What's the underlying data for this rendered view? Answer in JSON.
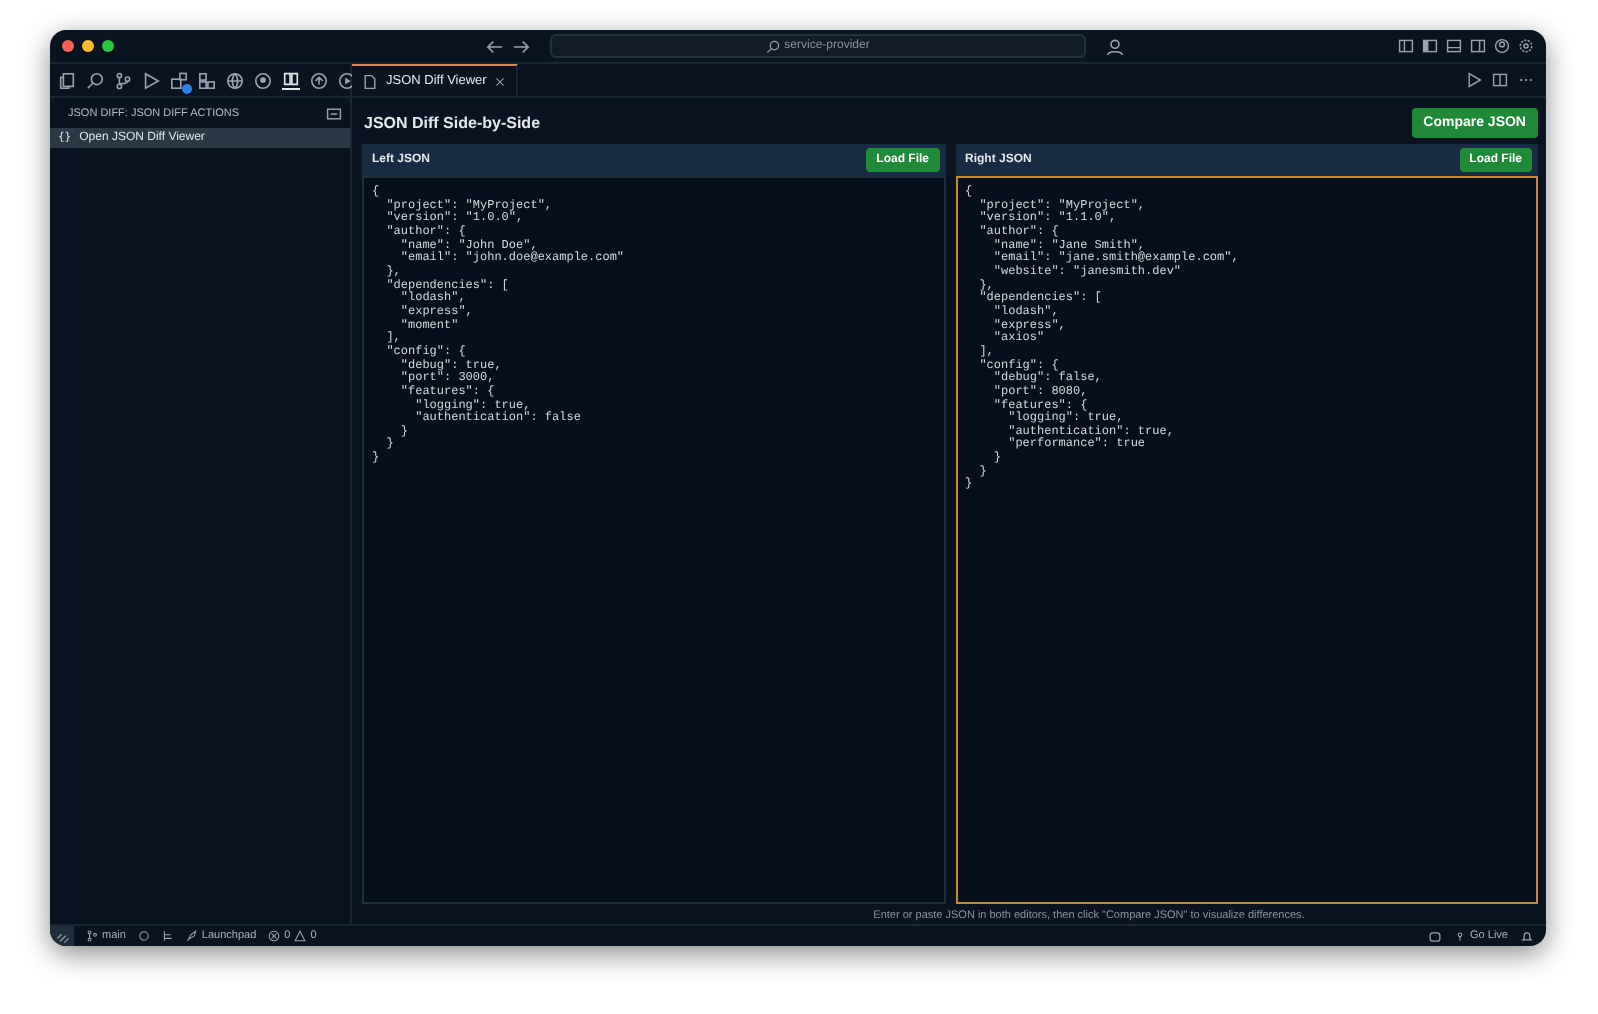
{
  "window": {
    "search": "service-provider"
  },
  "sidebar": {
    "title": "JSON DIFF: JSON DIFF ACTIONS",
    "items": [
      {
        "icon": "{}",
        "label": "Open JSON Diff Viewer",
        "selected": true
      }
    ]
  },
  "tabs": [
    {
      "label": "JSON Diff Viewer",
      "selected": true
    }
  ],
  "viewer": {
    "heading": "JSON Diff Side-by-Side",
    "compare_button": "Compare JSON",
    "editors": [
      {
        "title": "Left JSON",
        "button": "Load File",
        "focused": false,
        "content": "{\n  \"project\": \"MyProject\",\n  \"version\": \"1.0.0\",\n  \"author\": {\n    \"name\": \"John Doe\",\n    \"email\": \"john.doe@example.com\"\n  },\n  \"dependencies\": [\n    \"lodash\",\n    \"express\",\n    \"moment\"\n  ],\n  \"config\": {\n    \"debug\": true,\n    \"port\": 3000,\n    \"features\": {\n      \"logging\": true,\n      \"authentication\": false\n    }\n  }\n}"
      },
      {
        "title": "Right JSON",
        "button": "Load File",
        "focused": true,
        "content": "{\n  \"project\": \"MyProject\",\n  \"version\": \"1.1.0\",\n  \"author\": {\n    \"name\": \"Jane Smith\",\n    \"email\": \"jane.smith@example.com\",\n    \"website\": \"janesmith.dev\"\n  },\n  \"dependencies\": [\n    \"lodash\",\n    \"express\",\n    \"axios\"\n  ],\n  \"config\": {\n    \"debug\": false,\n    \"port\": 8080,\n    \"features\": {\n      \"logging\": true,\n      \"authentication\": true,\n      \"performance\": true\n    }\n  }\n}"
      }
    ],
    "hint": "Enter or paste JSON in both editors, then click \"Compare JSON\" to visualize differences."
  },
  "status_bar": {
    "branch": "main",
    "launchpad": "Launchpad",
    "errors": "0",
    "warnings": "0",
    "go_live": "Go Live"
  }
}
